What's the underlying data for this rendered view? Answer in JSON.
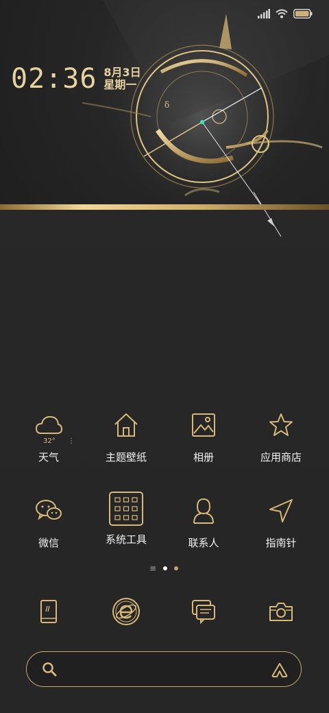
{
  "status_bar": {
    "icons": [
      "signal-icon",
      "wifi-icon",
      "battery-icon"
    ]
  },
  "clock": {
    "time": "02:36",
    "date": "8月3日",
    "weekday": "星期一"
  },
  "apps": [
    {
      "label": "天气",
      "icon": "cloud-icon",
      "temp": "32°"
    },
    {
      "label": "主题壁纸",
      "icon": "home-icon"
    },
    {
      "label": "相册",
      "icon": "image-icon"
    },
    {
      "label": "应用商店",
      "icon": "star-icon"
    },
    {
      "label": "微信",
      "icon": "chat-bubbles-icon"
    },
    {
      "label": "系统工具",
      "icon": "folder-grid-icon"
    },
    {
      "label": "联系人",
      "icon": "person-icon"
    },
    {
      "label": "指南针",
      "icon": "navigation-arrow-icon"
    }
  ],
  "page_indicator": {
    "pages": 2,
    "active": 0
  },
  "dock": [
    "phone-icon",
    "browser-icon",
    "messages-icon",
    "camera-icon"
  ],
  "colors": {
    "gold": "#d9b97a",
    "gold_light": "#f1d79a",
    "background": "#262626",
    "label": "#f0f0f0"
  }
}
